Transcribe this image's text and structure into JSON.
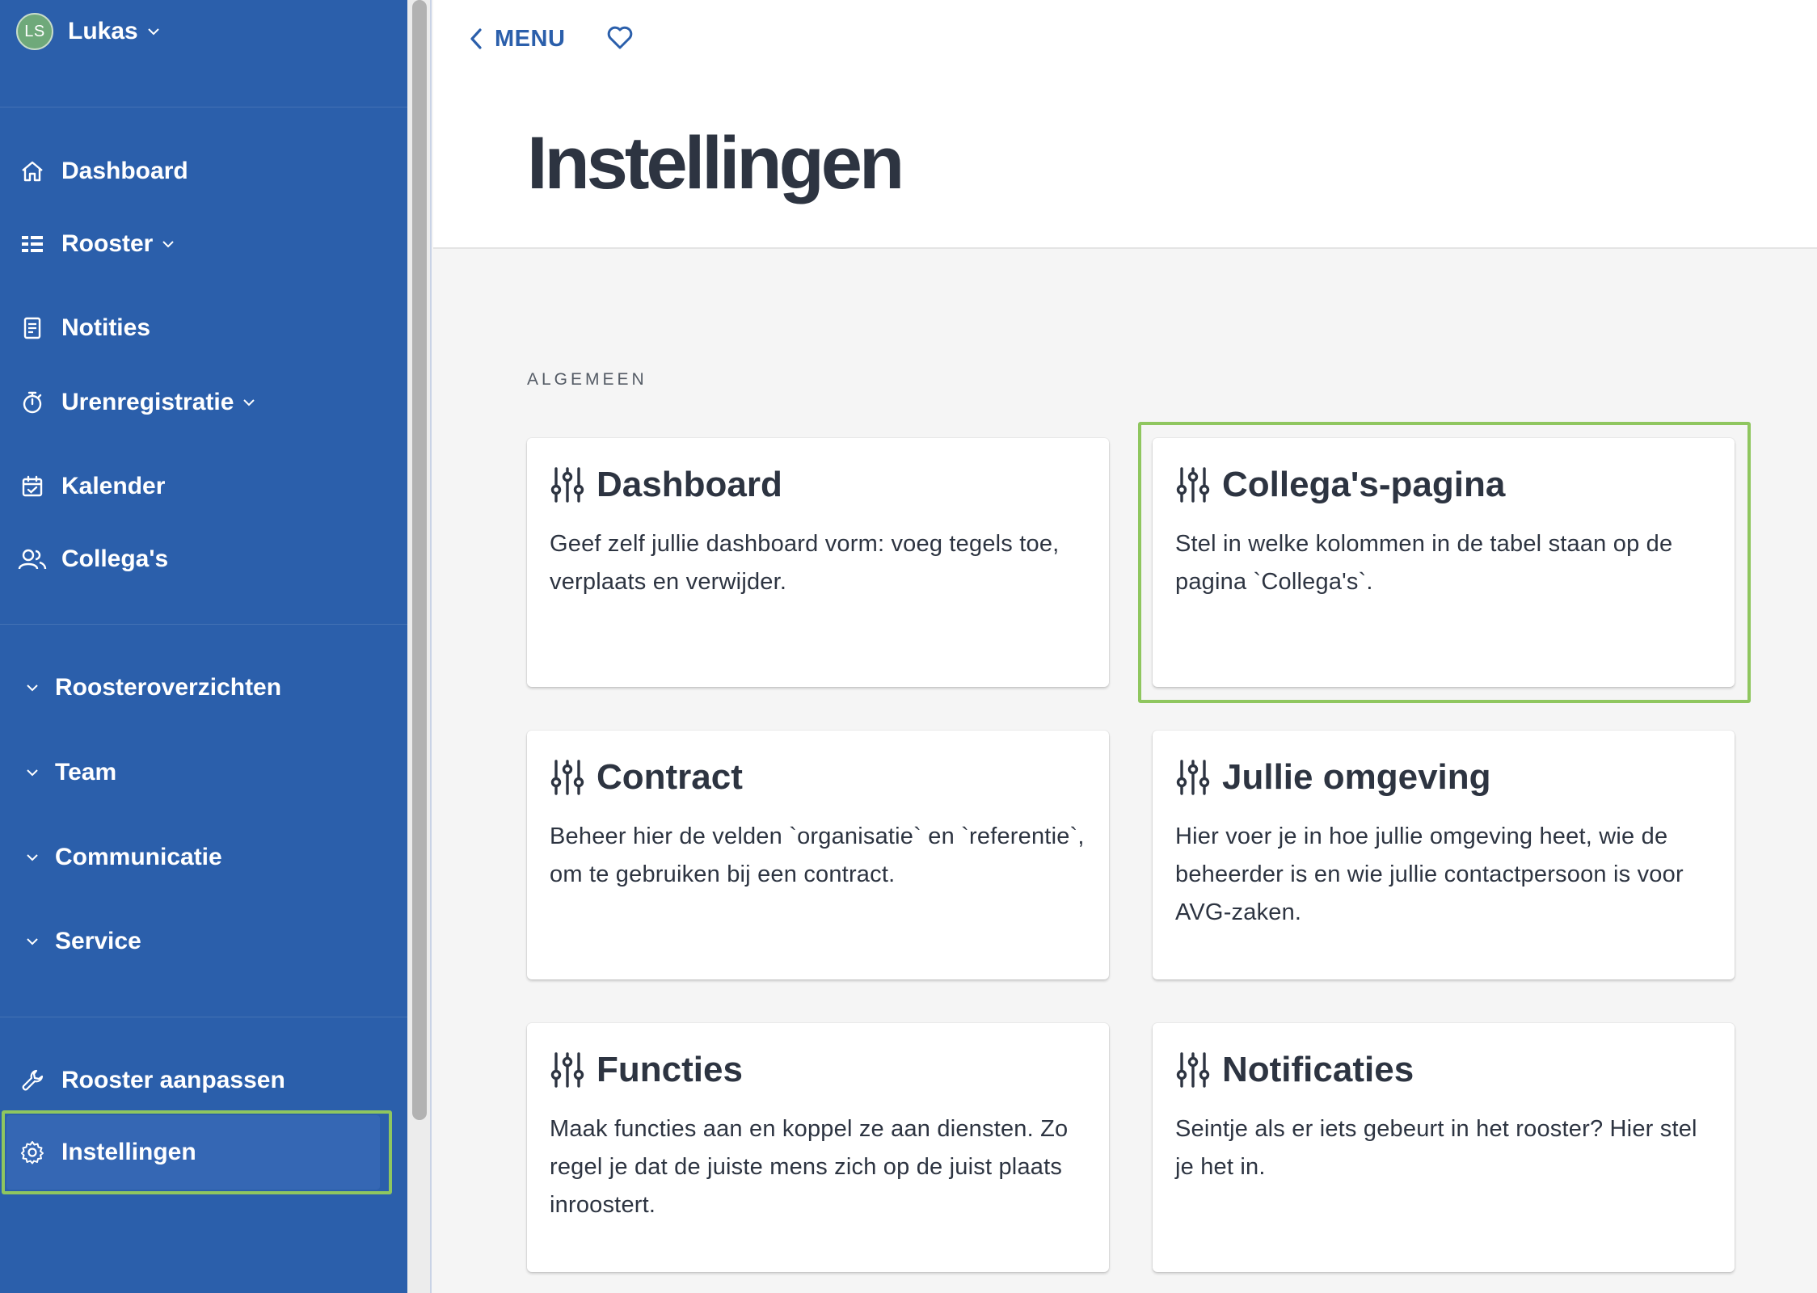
{
  "user": {
    "initials": "LS",
    "name": "Lukas"
  },
  "sidebar": {
    "nav": [
      {
        "label": "Dashboard",
        "icon": "home-icon"
      },
      {
        "label": "Rooster",
        "icon": "schedule-icon"
      },
      {
        "label": "Notities",
        "icon": "note-icon"
      },
      {
        "label": "Urenregistratie",
        "icon": "stopwatch-icon"
      },
      {
        "label": "Kalender",
        "icon": "calendar-icon"
      },
      {
        "label": "Collega's",
        "icon": "users-icon"
      }
    ],
    "groups": [
      "Roosteroverzichten",
      "Team",
      "Communicatie",
      "Service"
    ],
    "bottom": [
      {
        "label": "Rooster aanpassen",
        "icon": "wrench-icon"
      },
      {
        "label": "Instellingen",
        "icon": "gear-icon",
        "active": true
      }
    ]
  },
  "header": {
    "back_label": "MENU",
    "title": "Instellingen"
  },
  "section_label": "ALGEMEEN",
  "cards": [
    {
      "title": "Dashboard",
      "description": "Geef zelf jullie dashboard vorm: voeg tegels toe, verplaats en verwijder."
    },
    {
      "title": "Collega's-pagina",
      "description": "Stel in welke kolommen in de tabel staan op de pagina `Collega's`."
    },
    {
      "title": "Contract",
      "description": "Beheer hier de velden `organisatie` en `referentie`, om te gebruiken bij een contract."
    },
    {
      "title": "Jullie omgeving",
      "description": "Hier voer je in hoe jullie omgeving heet, wie de beheerder is en wie jullie contactpersoon is voor AVG-zaken."
    },
    {
      "title": "Functies",
      "description": "Maak functies aan en koppel ze aan diensten. Zo regel je dat de juiste mens zich op de juist plaats inroostert."
    },
    {
      "title": "Notificaties",
      "description": "Seintje als er iets gebeurt in het rooster? Hier stel je het in."
    }
  ],
  "colors": {
    "sidebar_bg": "#2b5fab",
    "accent": "#2b5fab",
    "highlight": "#8fc65f",
    "text_dark": "#2d3441"
  }
}
